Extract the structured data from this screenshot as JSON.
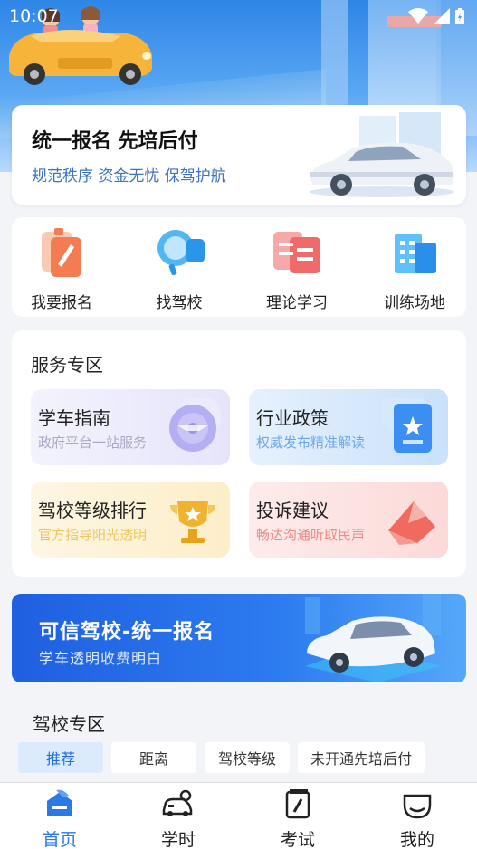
{
  "status_bar": {
    "time": "10:07",
    "wifi_icon": "wifi-icon",
    "signal_icon": "signal-icon",
    "battery_icon": "battery-icon"
  },
  "banner": {
    "title": "统一报名 先培后付",
    "subtitle": "规范秩序 资金无忧 保驾护航"
  },
  "quick_entries": [
    {
      "label": "我要报名",
      "icon": "signup-icon"
    },
    {
      "label": "找驾校",
      "icon": "find-school-icon"
    },
    {
      "label": "理论学习",
      "icon": "theory-study-icon"
    },
    {
      "label": "训练场地",
      "icon": "training-ground-icon"
    }
  ],
  "service_zone": {
    "title": "服务专区",
    "tiles": [
      {
        "title": "学车指南",
        "subtitle": "政府平台一站服务",
        "icon": "steering-wheel-icon",
        "accent": "#a9a4f2"
      },
      {
        "title": "行业政策",
        "subtitle": "权威发布精准解读",
        "icon": "policy-document-icon",
        "accent": "#3b8ff2"
      },
      {
        "title": "驾校等级排行",
        "subtitle": "官方指导阳光透明",
        "icon": "trophy-icon",
        "accent": "#f2b230"
      },
      {
        "title": "投诉建议",
        "subtitle": "畅达沟通听取民声",
        "icon": "complaint-envelope-icon",
        "accent": "#f06a60"
      }
    ]
  },
  "promo": {
    "title": "可信驾校-统一报名",
    "subtitle": "学车透明收费明白"
  },
  "school_zone": {
    "title": "驾校专区",
    "filters": [
      {
        "label": "推荐",
        "active": true
      },
      {
        "label": "距离",
        "active": false
      },
      {
        "label": "驾校等级",
        "active": false
      },
      {
        "label": "未开通先培后付",
        "active": false
      }
    ]
  },
  "bottom_nav": [
    {
      "label": "首页",
      "icon": "home-icon",
      "active": true
    },
    {
      "label": "学时",
      "icon": "study-hours-icon",
      "active": false
    },
    {
      "label": "考试",
      "icon": "exam-icon",
      "active": false
    },
    {
      "label": "我的",
      "icon": "profile-icon",
      "active": false
    }
  ],
  "colors": {
    "accent": "#2a79e6",
    "background": "#f2f4f8"
  }
}
